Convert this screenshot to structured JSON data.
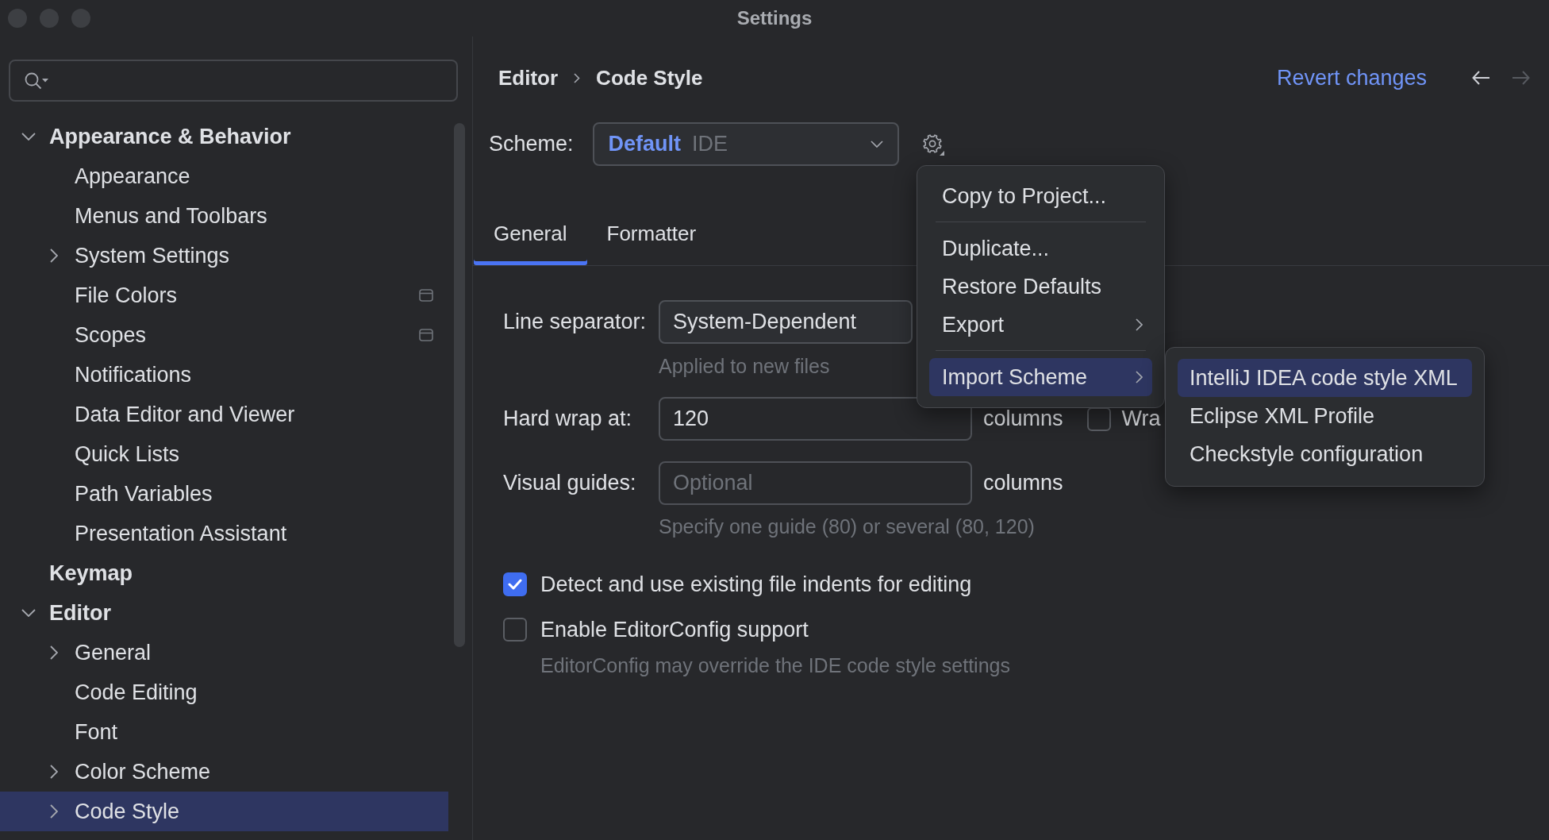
{
  "window": {
    "title": "Settings"
  },
  "sidebar": {
    "tree": [
      {
        "label": "Appearance & Behavior",
        "kind": "group",
        "expanded": true,
        "selected": false,
        "children": [
          {
            "label": "Appearance",
            "kind": "page",
            "selected": false,
            "project_level": false
          },
          {
            "label": "Menus and Toolbars",
            "kind": "page",
            "selected": false,
            "project_level": false
          },
          {
            "label": "System Settings",
            "kind": "group",
            "expanded": false,
            "selected": false,
            "project_level": false
          },
          {
            "label": "File Colors",
            "kind": "page",
            "selected": false,
            "project_level": true
          },
          {
            "label": "Scopes",
            "kind": "page",
            "selected": false,
            "project_level": true
          },
          {
            "label": "Notifications",
            "kind": "page",
            "selected": false,
            "project_level": false
          },
          {
            "label": "Data Editor and Viewer",
            "kind": "page",
            "selected": false,
            "project_level": false
          },
          {
            "label": "Quick Lists",
            "kind": "page",
            "selected": false,
            "project_level": false
          },
          {
            "label": "Path Variables",
            "kind": "page",
            "selected": false,
            "project_level": false
          },
          {
            "label": "Presentation Assistant",
            "kind": "page",
            "selected": false,
            "project_level": false
          }
        ]
      },
      {
        "label": "Keymap",
        "kind": "page",
        "selected": false
      },
      {
        "label": "Editor",
        "kind": "group",
        "expanded": true,
        "selected": false,
        "children": [
          {
            "label": "General",
            "kind": "group",
            "expanded": false,
            "selected": false,
            "project_level": false
          },
          {
            "label": "Code Editing",
            "kind": "page",
            "selected": false,
            "project_level": false
          },
          {
            "label": "Font",
            "kind": "page",
            "selected": false,
            "project_level": false
          },
          {
            "label": "Color Scheme",
            "kind": "group",
            "expanded": false,
            "selected": false,
            "project_level": false
          },
          {
            "label": "Code Style",
            "kind": "group",
            "expanded": false,
            "selected": true,
            "project_level": false
          }
        ]
      }
    ]
  },
  "header": {
    "breadcrumb": [
      "Editor",
      "Code Style"
    ],
    "revert_link": "Revert changes",
    "nav": [
      {
        "kind": "back",
        "disabled": false
      },
      {
        "kind": "forward",
        "disabled": true
      }
    ]
  },
  "scheme": {
    "label": "Scheme:",
    "name": "Default",
    "scope": "IDE"
  },
  "tabs": [
    {
      "label": "General",
      "selected": true
    },
    {
      "label": "Formatter",
      "selected": false
    }
  ],
  "form": {
    "line_separator": {
      "label": "Line separator:",
      "value": "System-Dependent",
      "hint": "Applied to new files"
    },
    "hard_wrap": {
      "label": "Hard wrap at:",
      "value": "120",
      "unit": "columns",
      "wrap_checkbox": {
        "label": "Wra",
        "checked": false
      }
    },
    "visual_guides": {
      "label": "Visual guides:",
      "placeholder": "Optional",
      "unit": "columns",
      "hint": "Specify one guide (80) or several (80, 120)"
    },
    "options": [
      {
        "label": "Detect and use existing file indents for editing",
        "checked": true
      },
      {
        "label": "Enable EditorConfig support",
        "checked": false,
        "hint": "EditorConfig may override the IDE code style settings"
      }
    ]
  },
  "scheme_menu": {
    "groups": [
      [
        {
          "label": "Copy to Project...",
          "has_submenu": false,
          "selected": false
        }
      ],
      [
        {
          "label": "Duplicate...",
          "has_submenu": false,
          "selected": false
        },
        {
          "label": "Restore Defaults",
          "has_submenu": false,
          "selected": false
        },
        {
          "label": "Export",
          "has_submenu": true,
          "selected": false
        }
      ],
      [
        {
          "label": "Import Scheme",
          "has_submenu": true,
          "selected": true
        }
      ]
    ]
  },
  "import_submenu": {
    "items": [
      {
        "label": "IntelliJ IDEA code style XML",
        "selected": true
      },
      {
        "label": "Eclipse XML Profile",
        "selected": false
      },
      {
        "label": "Checkstyle configuration",
        "selected": false
      }
    ]
  }
}
